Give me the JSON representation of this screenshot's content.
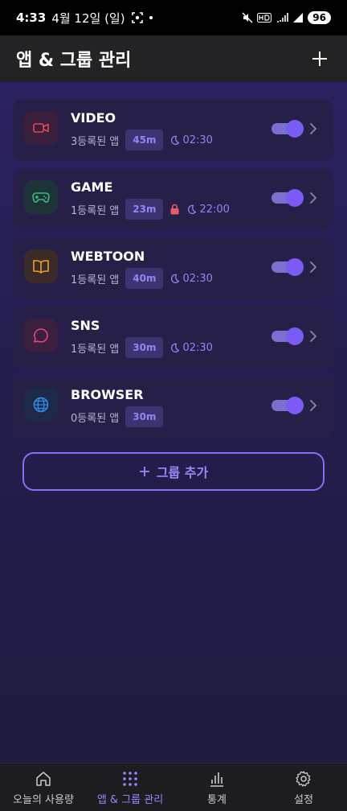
{
  "status_bar": {
    "time": "4:33",
    "date": "4월 12일 (일)",
    "battery": "96"
  },
  "header": {
    "title": "앱 & 그룹 관리",
    "add_icon": "plus-icon"
  },
  "groups": [
    {
      "name": "VIDEO",
      "apps": "3등록된 앱",
      "limit": "45m",
      "bedtime": "02:30",
      "locked": false,
      "icon": "video-camera-icon",
      "color": "#e8455a",
      "icon_bg": "#3a1f3a"
    },
    {
      "name": "GAME",
      "apps": "1등록된 앱",
      "limit": "23m",
      "bedtime": "22:00",
      "locked": true,
      "icon": "gamepad-icon",
      "color": "#35c07a",
      "icon_bg": "#1c3338"
    },
    {
      "name": "WEBTOON",
      "apps": "1등록된 앱",
      "limit": "40m",
      "bedtime": "02:30",
      "locked": false,
      "icon": "book-icon",
      "color": "#f0a21e",
      "icon_bg": "#3a2a28"
    },
    {
      "name": "SNS",
      "apps": "1등록된 앱",
      "limit": "30m",
      "bedtime": "02:30",
      "locked": false,
      "icon": "chat-bubble-icon",
      "color": "#e8457e",
      "icon_bg": "#3a1f3f"
    },
    {
      "name": "BROWSER",
      "apps": "0등록된 앱",
      "limit": "30m",
      "bedtime": "",
      "locked": false,
      "icon": "globe-icon",
      "color": "#2e8be6",
      "icon_bg": "#1c2a48"
    }
  ],
  "add_group": {
    "label": "그룹 추가"
  },
  "nav": {
    "usage": "오늘의 사용량",
    "manage": "앱 & 그룹 관리",
    "stats": "통계",
    "settings": "설정"
  },
  "colors": {
    "accent": "#8a6df2",
    "lock": "#e85a6a",
    "badge_text": "#8e86f5"
  }
}
